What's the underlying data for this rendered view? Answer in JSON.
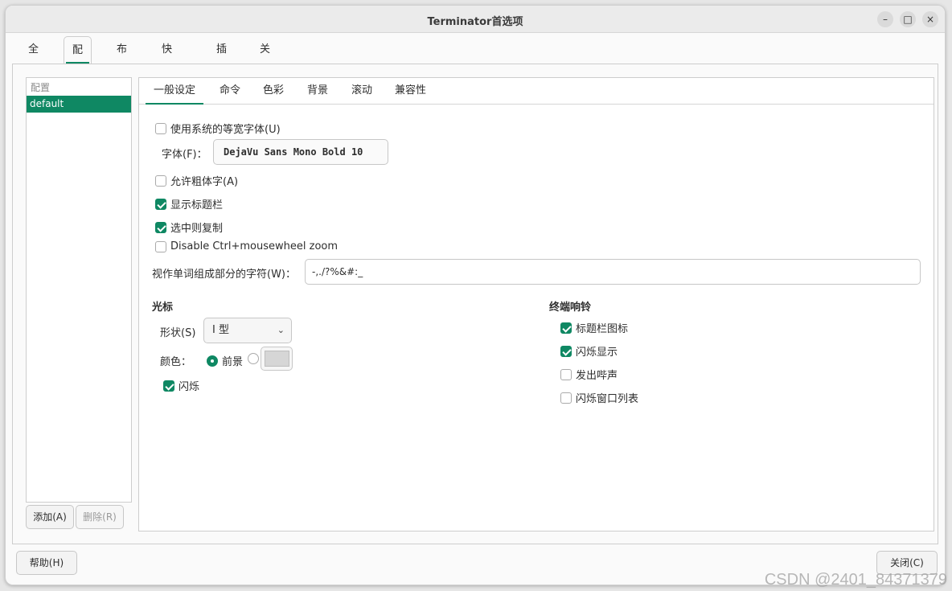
{
  "window": {
    "title": "Terminator首选项",
    "minimize": "–",
    "maximize": "□",
    "close": "×"
  },
  "main_tabs": [
    "全局",
    "配置",
    "布局",
    "快捷键",
    "插件",
    "关于"
  ],
  "main_tab_active": "配置",
  "profiles": {
    "header": "配置",
    "items": [
      "default"
    ],
    "add_label": "添加(A)",
    "remove_label": "删除(R)"
  },
  "settings_tabs": [
    "一般设定",
    "命令",
    "色彩",
    "背景",
    "滚动",
    "兼容性"
  ],
  "settings_tab_active": "一般设定",
  "general": {
    "use_system_font": {
      "label": "使用系统的等宽字体(U)",
      "checked": false
    },
    "font_label": "字体(F)：",
    "font_value": "DejaVu Sans Mono Bold  10",
    "allow_bold": {
      "label": "允许粗体字(A)",
      "checked": false
    },
    "show_titlebar": {
      "label": "显示标题栏",
      "checked": true
    },
    "copy_on_select": {
      "label": "选中则复制",
      "checked": true
    },
    "disable_zoom": {
      "label": "Disable Ctrl+mousewheel zoom",
      "checked": false
    },
    "word_chars_label": "视作单词组成部分的字符(W)：",
    "word_chars_value": "-,./?%&#:_"
  },
  "cursor": {
    "title": "光标",
    "shape_label": "形状(S)",
    "shape_value": "I 型",
    "color_label": "颜色：",
    "color_fg_label": "前景",
    "color_fg_selected": true,
    "custom_color": "#d6d6d6",
    "blink": {
      "label": "闪烁",
      "checked": true
    }
  },
  "bell": {
    "title": "终端响铃",
    "items": [
      {
        "label": "标题栏图标",
        "checked": true
      },
      {
        "label": "闪烁显示",
        "checked": true
      },
      {
        "label": "发出哔声",
        "checked": false
      },
      {
        "label": "闪烁窗口列表",
        "checked": false
      }
    ]
  },
  "footer": {
    "help_label": "帮助(H)",
    "close_label": "关闭(C)"
  },
  "watermark": "CSDN @2401_84371379",
  "colors": {
    "accent": "#0f8863"
  }
}
